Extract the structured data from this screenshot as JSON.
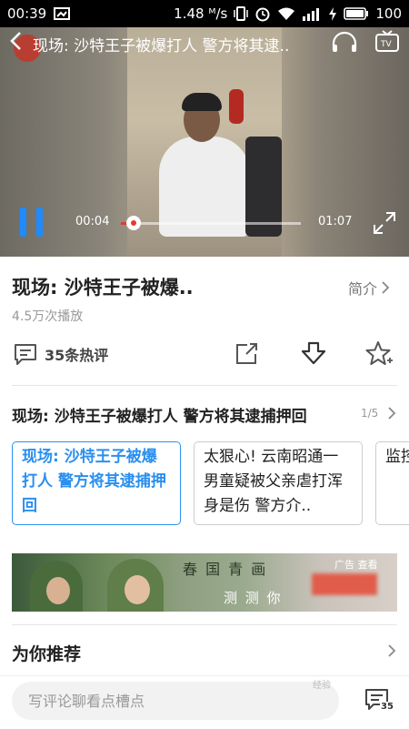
{
  "status_bar": {
    "time": "00:39",
    "speed": "1.48 ᴹ/s",
    "battery": "100"
  },
  "video": {
    "title": "现场: 沙特王子被爆打人  警方将其逮..",
    "current_time": "00:04",
    "total_time": "01:07",
    "progress": 0.07
  },
  "info": {
    "title": "现场: 沙特王子被爆..",
    "intro_label": "简介",
    "plays": "4.5万次播放",
    "comments_label": "35条热评"
  },
  "playlist": {
    "title": "现场: 沙特王子被爆打人 警方将其逮捕押回",
    "count": "1/5",
    "items": [
      {
        "text": "现场: 沙特王子被爆打人 警方将其逮捕押回"
      },
      {
        "text": "太狠心! 云南昭通一男童疑被父亲虐打浑身是伤 警方介.."
      },
      {
        "text": "监控：事故后还寡"
      }
    ]
  },
  "ad": {
    "text1": "春 国 青 画",
    "text2": "测 测 你",
    "tag": "广告  查看"
  },
  "recommend": {
    "title": "为你推荐"
  },
  "bottom_bar": {
    "placeholder": "写评论聊看点槽点",
    "comment_count": "35"
  },
  "watermark": "经验"
}
